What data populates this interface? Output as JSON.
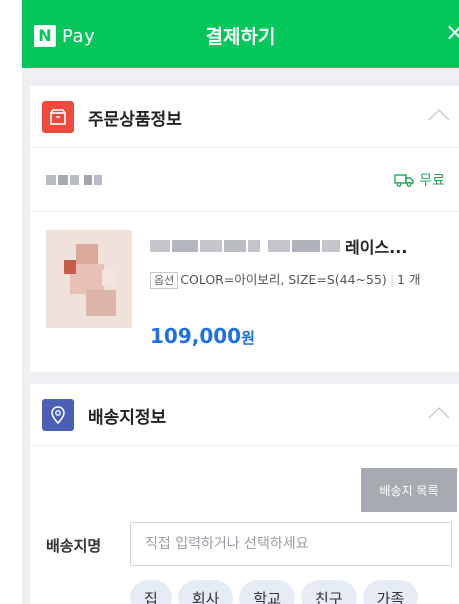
{
  "header": {
    "brand_n": "N",
    "brand_pay": "Pay",
    "title": "결제하기",
    "close": "×"
  },
  "order_section": {
    "title": "주문상품정보",
    "shipping_label": "무료",
    "product": {
      "name_suffix": "레이스...",
      "option_tag": "옵션",
      "option_text": "COLOR=아이보리, SIZE=S(44~55)",
      "quantity": "1 개",
      "price": "109,000",
      "currency": "원"
    }
  },
  "delivery_section": {
    "title": "배송지정보",
    "address_list_button": "배송지 목록",
    "name_label": "배송지명",
    "name_placeholder": "직접 입력하거나 선택하세요",
    "chips": [
      "집",
      "회사",
      "학교",
      "친구",
      "가족"
    ]
  },
  "colors": {
    "brand_green": "#03c75a",
    "price_blue": "#1f6fe5",
    "order_icon": "#ef4b3c",
    "delivery_icon": "#4b60b4"
  }
}
